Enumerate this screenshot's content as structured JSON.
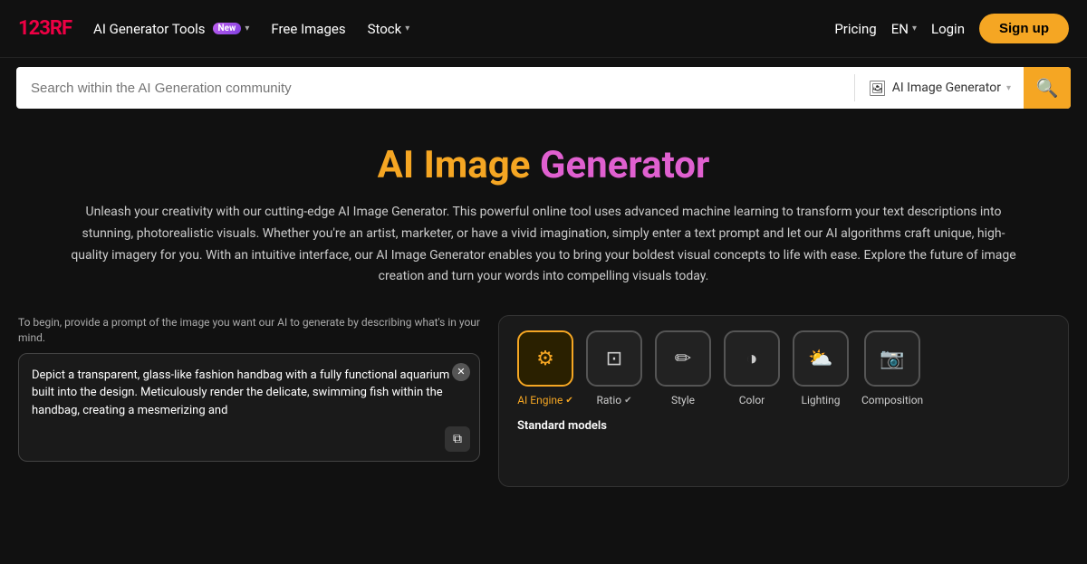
{
  "logo": {
    "text": "123RF"
  },
  "navbar": {
    "ai_tools_label": "AI Generator Tools",
    "ai_tools_badge": "New",
    "free_images_label": "Free Images",
    "stock_label": "Stock",
    "pricing_label": "Pricing",
    "lang_label": "EN",
    "login_label": "Login",
    "signup_label": "Sign up"
  },
  "search": {
    "placeholder": "Search within the AI Generation community",
    "type_label": "AI Image Generator",
    "search_icon": "🔍"
  },
  "hero": {
    "title_part1": "AI Image ",
    "title_part2": "Generator",
    "description": "Unleash your creativity with our cutting-edge AI Image Generator. This powerful online tool uses advanced machine learning to transform your text descriptions into stunning, photorealistic visuals. Whether you're an artist, marketer, or have a vivid imagination, simply enter a text prompt and let our AI algorithms craft unique, high-quality imagery for you. With an intuitive interface, our AI Image Generator enables you to bring your boldest visual concepts to life with ease. Explore the future of image creation and turn your words into compelling visuals today."
  },
  "left_panel": {
    "hint": "To begin, provide a prompt of the image you want our AI to generate by describing what's in your mind.",
    "prompt_text": "Depict a transparent, glass-like fashion handbag with a fully functional aquarium built into the design. Meticulously render the delicate, swimming fish within the handbag, creating a mesmerizing and"
  },
  "tools": [
    {
      "id": "ai-engine",
      "icon": "⚙",
      "label": "AI Engine",
      "active": true,
      "has_check": true
    },
    {
      "id": "ratio",
      "icon": "⊡",
      "label": "Ratio",
      "active": false,
      "has_check": true
    },
    {
      "id": "style",
      "icon": "✏",
      "label": "Style",
      "active": false,
      "has_check": false
    },
    {
      "id": "color",
      "icon": "◑",
      "label": "Color",
      "active": false,
      "has_check": false
    },
    {
      "id": "lighting",
      "icon": "☁",
      "label": "Lighting",
      "active": false,
      "has_check": false
    },
    {
      "id": "composition",
      "icon": "📷",
      "label": "Composition",
      "active": false,
      "has_check": false
    }
  ],
  "standard_models_label": "Standard models"
}
